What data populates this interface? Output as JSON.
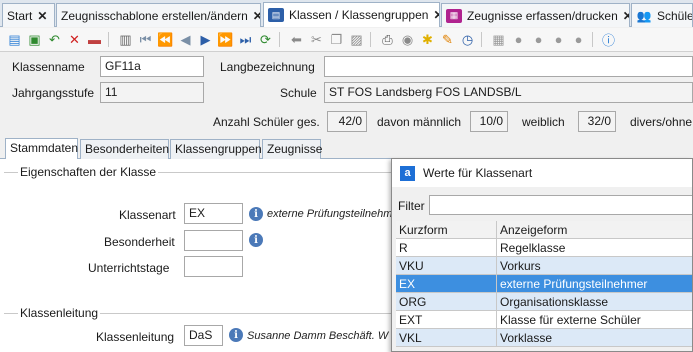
{
  "tabs": [
    {
      "label": "Start",
      "active": false
    },
    {
      "label": "Zeugnisschablone erstellen/ändern",
      "active": false
    },
    {
      "label": "Klassen / Klassengruppen",
      "active": true
    },
    {
      "label": "Zeugnisse erfassen/drucken",
      "active": false
    },
    {
      "label": "Schüler",
      "active": false
    }
  ],
  "header": {
    "klassenname_label": "Klassenname",
    "klassenname_value": "GF11a",
    "langbezeichnung_label": "Langbezeichnung",
    "langbezeichnung_value": "",
    "jahrgangsstufe_label": "Jahrgangsstufe",
    "jahrgangsstufe_value": "11",
    "schule_label": "Schule",
    "schule_value": "ST FOS Landsberg FOS LANDSB/L",
    "anzahl_label": "Anzahl Schüler ges.",
    "anzahl_value": "42/0",
    "maennlich_label": "davon männlich",
    "maennlich_value": "10/0",
    "weiblich_label": "weiblich",
    "weiblich_value": "32/0",
    "divers_label": "divers/ohne"
  },
  "inner_tabs": [
    {
      "label": "Stammdaten",
      "active": true
    },
    {
      "label": "Besonderheiten",
      "active": false
    },
    {
      "label": "Klassengruppen",
      "active": false
    },
    {
      "label": "Zeugnisse",
      "active": false
    }
  ],
  "eigenschaften": {
    "title": "Eigenschaften der Klasse",
    "klassenart_label": "Klassenart",
    "klassenart_value": "EX",
    "klassenart_hint": "externe Prüfungsteilnehmer",
    "besonderheit_label": "Besonderheit",
    "besonderheit_value": "",
    "unterrichtstage_label": "Unterrichtstage",
    "unterrichtstage_value": ""
  },
  "klassenleitung": {
    "title": "Klassenleitung",
    "label": "Klassenleitung",
    "value": "DaS",
    "hint": "Susanne Damm Beschäft. W"
  },
  "popup": {
    "title": "Werte für Klassenart",
    "filter_label": "Filter",
    "filter_value": "",
    "columns": [
      "Kurzform",
      "Anzeigeform"
    ],
    "rows": [
      {
        "kurz": "R",
        "anzeige": "Regelklasse"
      },
      {
        "kurz": "VKU",
        "anzeige": "Vorkurs"
      },
      {
        "kurz": "EX",
        "anzeige": "externe Prüfungsteilnehmer"
      },
      {
        "kurz": "ORG",
        "anzeige": "Organisationsklasse"
      },
      {
        "kurz": "EXT",
        "anzeige": "Klasse für externe Schüler"
      },
      {
        "kurz": "VKL",
        "anzeige": "Vorklasse"
      }
    ],
    "selected_index": 2
  }
}
